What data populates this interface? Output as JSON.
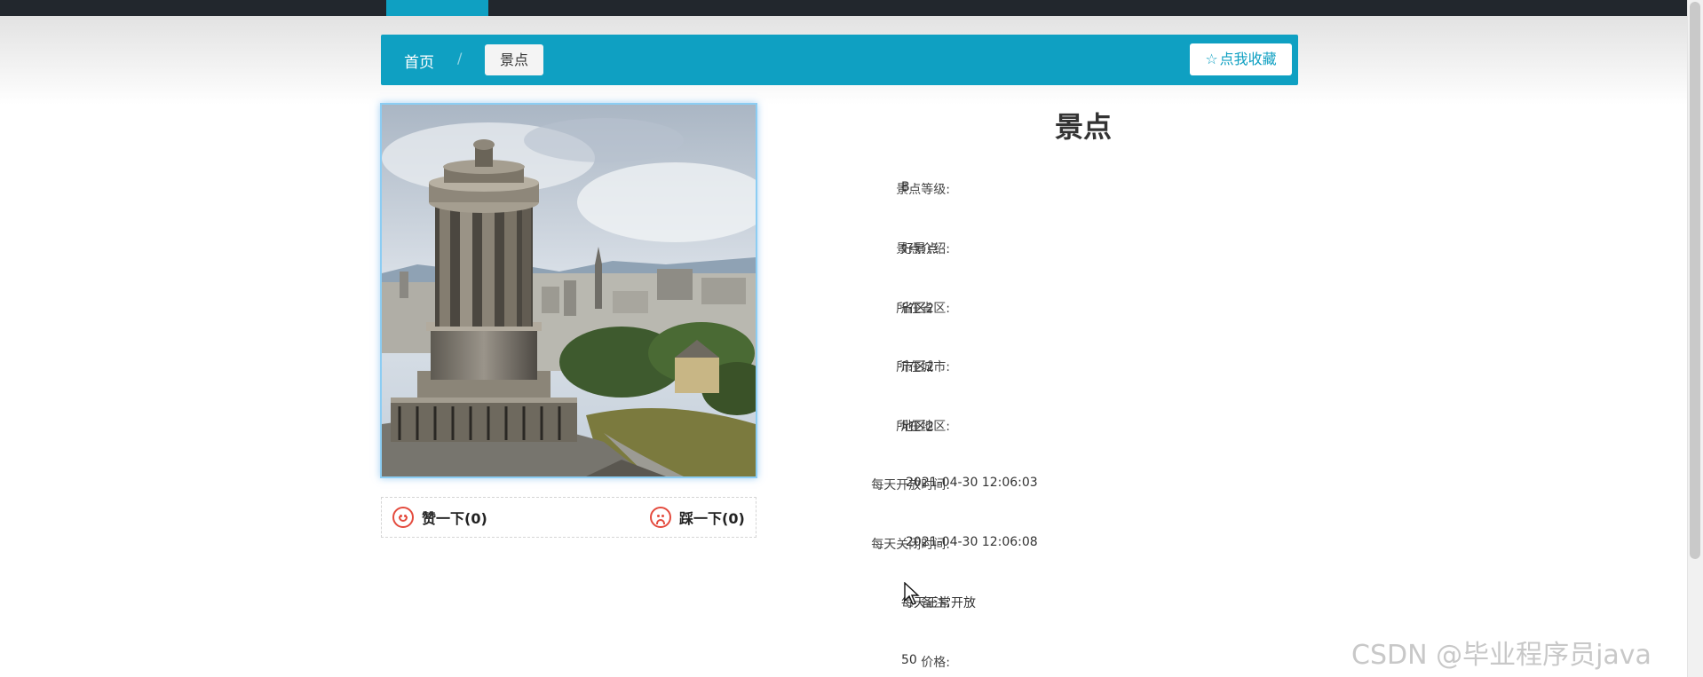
{
  "breadcrumb": {
    "home": "首页",
    "separator": "/",
    "current": "景点"
  },
  "favorite_button": {
    "icon": "star-outline-icon",
    "label": "点我收藏"
  },
  "votes": {
    "like_label": "赞一下(0)",
    "dislike_label": "踩一下(0)"
  },
  "detail": {
    "title": "景点",
    "rows": [
      {
        "label": "景点等级:",
        "value": "B"
      },
      {
        "label": "景点介绍:",
        "value": "好景点"
      },
      {
        "label": "所在省区:",
        "value": "省区2"
      },
      {
        "label": "所在城市:",
        "value": "市区2"
      },
      {
        "label": "所在地区:",
        "value": "地区2"
      },
      {
        "label": "每天开放时间:",
        "value": "2021-04-30 12:06:03"
      },
      {
        "label": "每天关闭时间:",
        "value": "2021-04-30 12:06:08"
      },
      {
        "label": "备注:",
        "value": "每天正常开放"
      },
      {
        "label": "价格:",
        "value": "50"
      }
    ]
  },
  "watermark": "CSDN @毕业程序员java",
  "colors": {
    "accent": "#0fa0c2",
    "topbar": "#22272d",
    "vote_icon": "#e44b3e"
  }
}
